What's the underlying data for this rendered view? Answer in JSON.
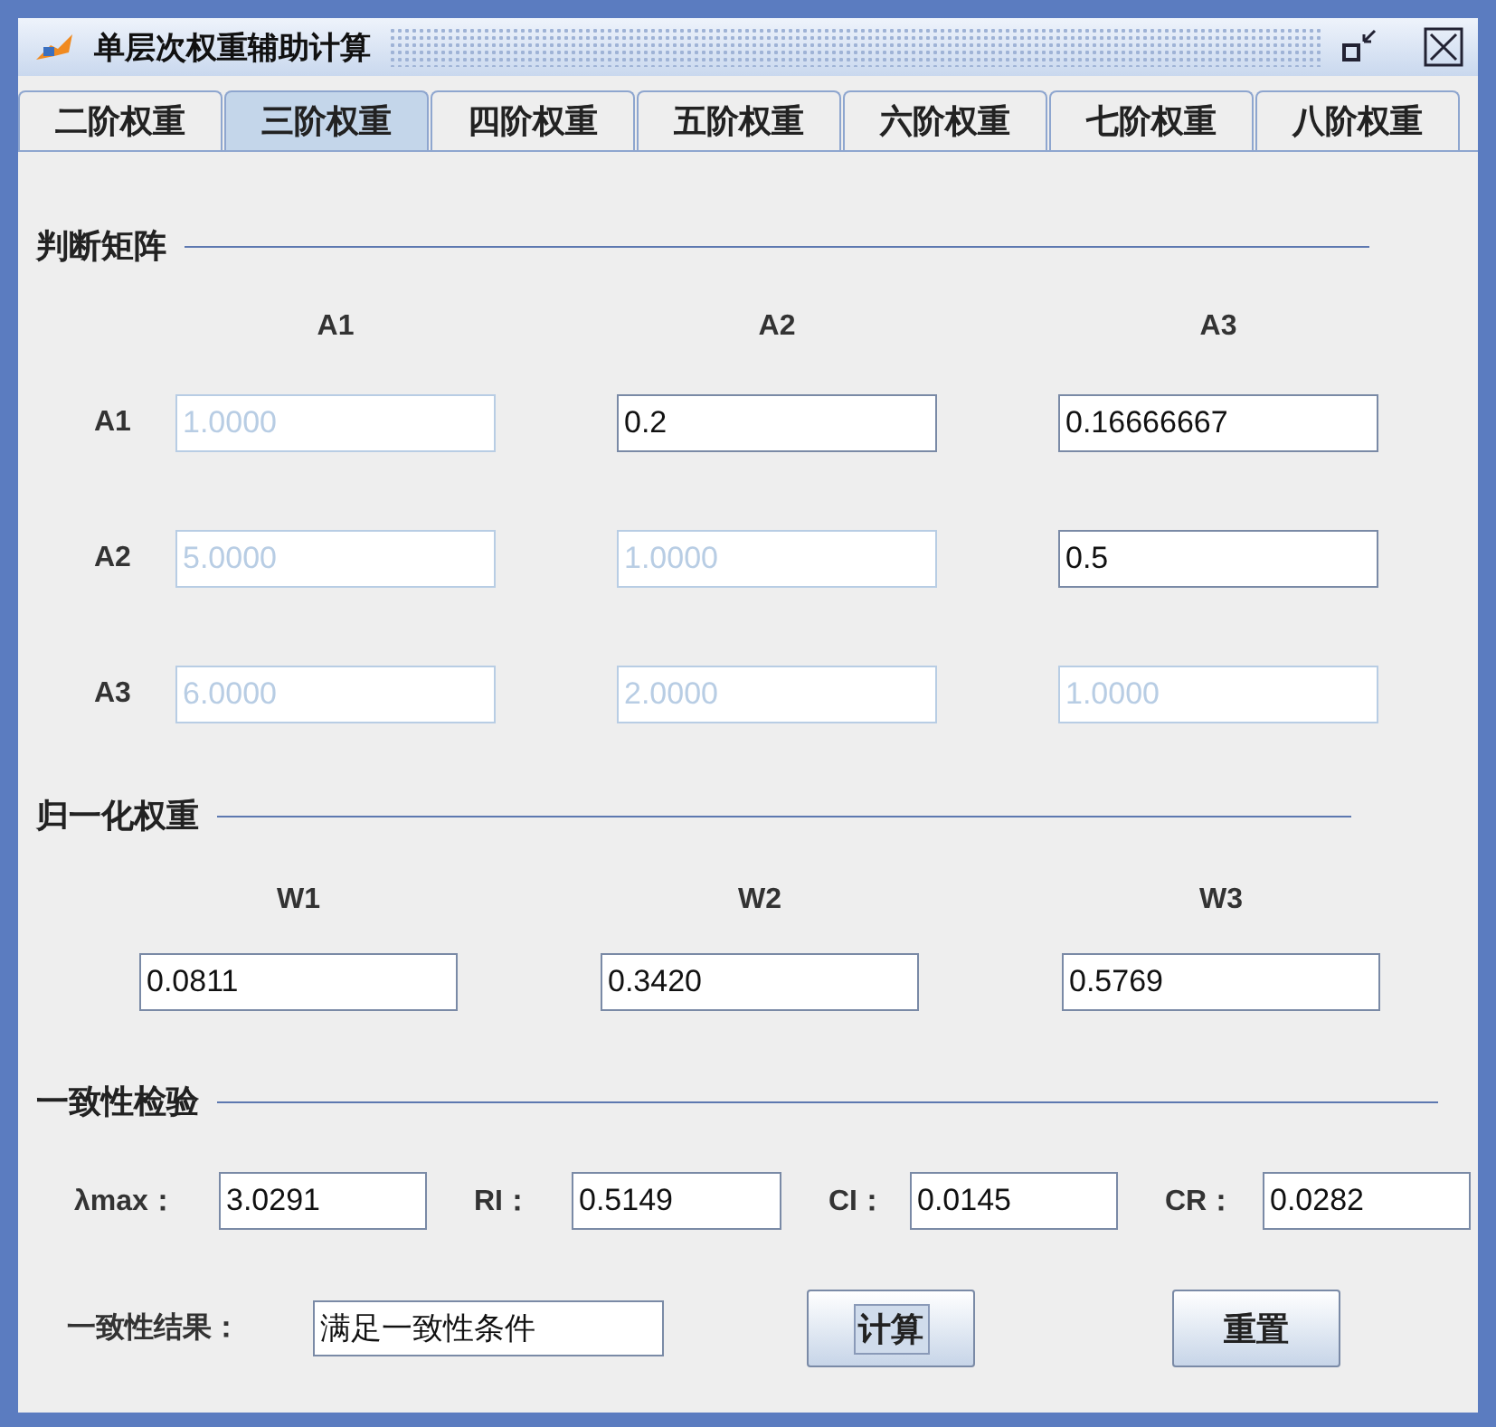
{
  "window": {
    "title": "单层次权重辅助计算"
  },
  "tabs": [
    {
      "label": "二阶权重",
      "selected": false
    },
    {
      "label": "三阶权重",
      "selected": true
    },
    {
      "label": "四阶权重",
      "selected": false
    },
    {
      "label": "五阶权重",
      "selected": false
    },
    {
      "label": "六阶权重",
      "selected": false
    },
    {
      "label": "七阶权重",
      "selected": false
    },
    {
      "label": "八阶权重",
      "selected": false
    }
  ],
  "matrix": {
    "title": "判断矩阵",
    "columns": [
      "A1",
      "A2",
      "A3"
    ],
    "rows": [
      {
        "label": "A1",
        "cells": [
          {
            "value": "1.0000",
            "disabled": true
          },
          {
            "value": "0.2",
            "disabled": false
          },
          {
            "value": "0.16666667",
            "disabled": false
          }
        ]
      },
      {
        "label": "A2",
        "cells": [
          {
            "value": "5.0000",
            "disabled": true
          },
          {
            "value": "1.0000",
            "disabled": true
          },
          {
            "value": "0.5",
            "disabled": false
          }
        ]
      },
      {
        "label": "A3",
        "cells": [
          {
            "value": "6.0000",
            "disabled": true
          },
          {
            "value": "2.0000",
            "disabled": true
          },
          {
            "value": "1.0000",
            "disabled": true
          }
        ]
      }
    ]
  },
  "weights": {
    "title": "归一化权重",
    "items": [
      {
        "label": "W1",
        "value": "0.0811"
      },
      {
        "label": "W2",
        "value": "0.3420"
      },
      {
        "label": "W3",
        "value": "0.5769"
      }
    ]
  },
  "consistency": {
    "title": "一致性检验",
    "metrics": [
      {
        "label": "λmax：",
        "value": "3.0291"
      },
      {
        "label": "RI：",
        "value": "0.5149"
      },
      {
        "label": "CI：",
        "value": "0.0145"
      },
      {
        "label": "CR：",
        "value": "0.0282"
      }
    ],
    "result_label": "一致性结果：",
    "result_value": "满足一致性条件"
  },
  "buttons": [
    {
      "label": "计算",
      "focused": true
    },
    {
      "label": "重置",
      "focused": false
    }
  ]
}
